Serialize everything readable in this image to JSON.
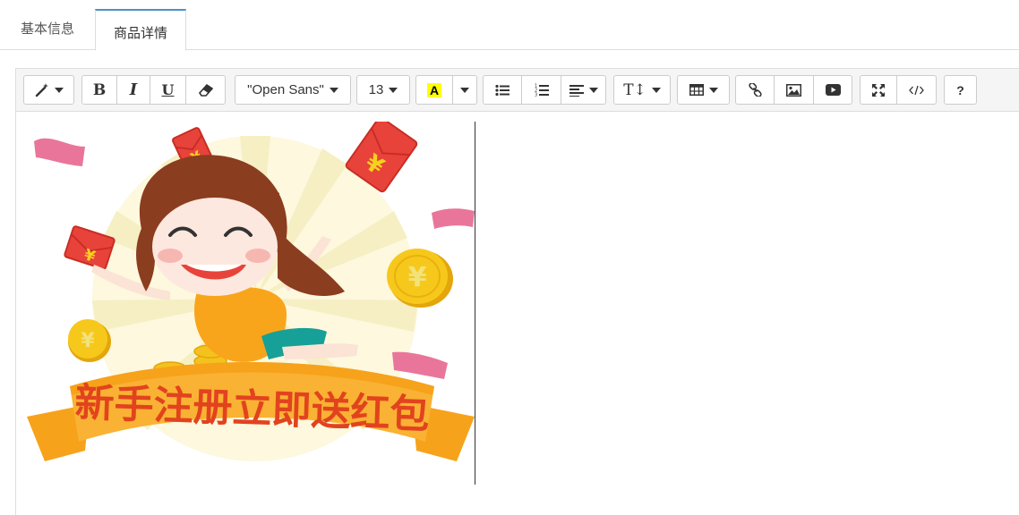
{
  "tabs": [
    {
      "label": "基本信息",
      "active": false
    },
    {
      "label": "商品详情",
      "active": true
    }
  ],
  "toolbar": {
    "font_family": "\"Open Sans\"",
    "font_size": "13",
    "bold_label": "B",
    "italic_label": "I",
    "underline_label": "U",
    "highlight_label": "A",
    "help_label": "?",
    "text_height_label": "T↕",
    "icons": [
      "magic-wand-icon",
      "bold-icon",
      "italic-icon",
      "underline-icon",
      "eraser-icon",
      "font-family",
      "font-size",
      "highlight-color-icon",
      "unordered-list-icon",
      "ordered-list-icon",
      "paragraph-align-icon",
      "line-height-icon",
      "table-icon",
      "link-icon",
      "picture-icon",
      "video-icon",
      "fullscreen-icon",
      "code-view-icon",
      "help-icon"
    ]
  },
  "content": {
    "banner_text": "新手注册立即送红包"
  },
  "colors": {
    "active_tab_border": "#4a90c8",
    "toolbar_bg": "#f5f5f5",
    "banner_orange": "#f7a21b",
    "banner_text": "#e2431e",
    "red_packet": "#e8433a",
    "coin": "#f5c518"
  }
}
